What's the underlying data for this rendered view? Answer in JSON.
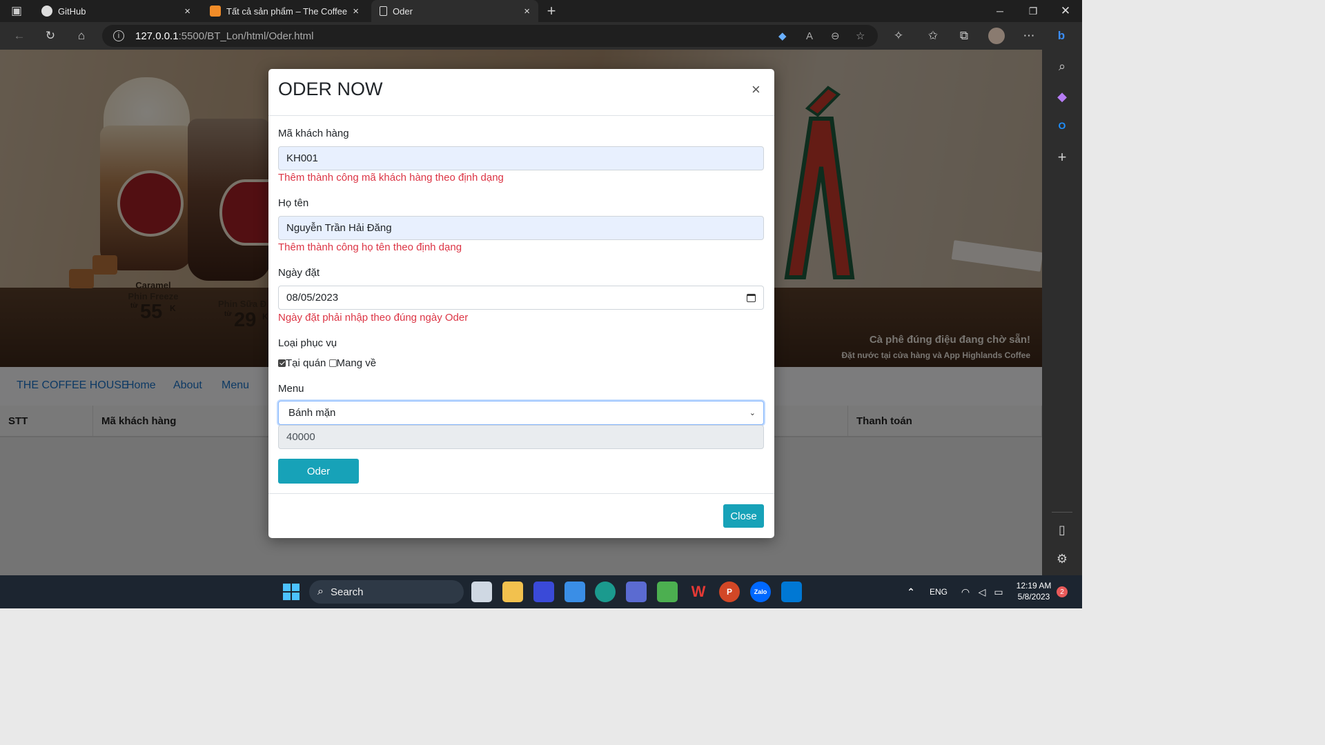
{
  "browser": {
    "tabs": [
      {
        "title": "GitHub",
        "close": "×"
      },
      {
        "title": "Tất cả sản phẩm – The Coffee Ho",
        "close": "×"
      },
      {
        "title": "Oder",
        "close": "×"
      }
    ],
    "new_tab": "+",
    "url_host": "127.0.0.1",
    "url_rest": ":5500/BT_Lon/html/Oder.html"
  },
  "banner": {
    "product1_name_line1": "Caramel",
    "product1_name_line2": "Phin Freeze",
    "product1_from": "từ",
    "product1_price": "55",
    "product1_unit": "K",
    "product2_name": "Phin Sữa Đ",
    "product2_from": "từ",
    "product2_price": "29",
    "product2_unit": "K",
    "slogan_line1": "Cà phê đúng điệu đang chờ sẵn!",
    "slogan_line2": "Đặt nước tại cửa hàng và App Highlands Coffee"
  },
  "navbar": {
    "brand": "THE COFFEE HOUSE",
    "links": [
      "Home",
      "About",
      "Menu"
    ]
  },
  "table": {
    "headers": [
      "STT",
      "Mã khách hàng",
      "Thanh toán"
    ]
  },
  "modal": {
    "title": "ODER NOW",
    "close_x": "×",
    "customer_id_label": "Mã khách hàng",
    "customer_id_value": "KH001",
    "customer_id_msg": "Thêm thành công mã khách hàng theo định dạng",
    "name_label": "Họ tên",
    "name_value": "Nguyễn Trần Hải Đăng",
    "name_msg": "Thêm thành công họ tên theo định dạng",
    "date_label": "Ngày đặt",
    "date_value": "08/05/2023",
    "date_msg": "Ngày đặt phải nhập theo đúng ngày Oder",
    "service_label": "Loại phục vụ",
    "service_options": [
      {
        "label": "Tại quán",
        "checked": true
      },
      {
        "label": "Mang về",
        "checked": false
      }
    ],
    "menu_label": "Menu",
    "menu_selected": "Bánh mặn",
    "price_value": "40000",
    "oder_button": "Oder",
    "close_button": "Close"
  },
  "taskbar": {
    "search_label": "Search",
    "lang": "ENG",
    "time": "12:19 AM",
    "date": "5/8/2023",
    "notif_count": "2"
  },
  "colors": {
    "accent_teal": "#17a2b8",
    "error_red": "#dc3545",
    "link_blue": "#1a73c9"
  }
}
